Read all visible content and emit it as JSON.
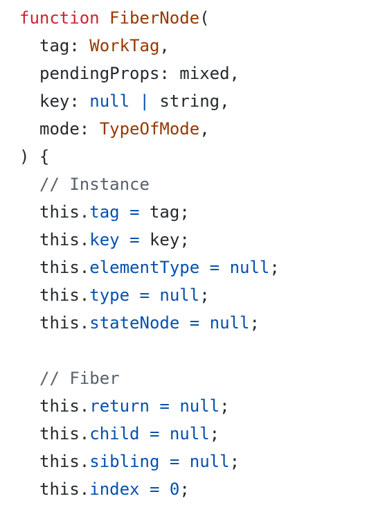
{
  "code": {
    "language": "javascript",
    "lines": [
      {
        "indent": 0,
        "tokens": [
          {
            "t": "function",
            "k": "keyword"
          },
          {
            "t": " ",
            "k": "plain"
          },
          {
            "t": "FiberNode",
            "k": "func"
          },
          {
            "t": "(",
            "k": "plain"
          }
        ]
      },
      {
        "indent": 1,
        "tokens": [
          {
            "t": "tag",
            "k": "param"
          },
          {
            "t": ": ",
            "k": "plain"
          },
          {
            "t": "WorkTag",
            "k": "type"
          },
          {
            "t": ",",
            "k": "plain"
          }
        ]
      },
      {
        "indent": 1,
        "tokens": [
          {
            "t": "pendingProps",
            "k": "param"
          },
          {
            "t": ": ",
            "k": "plain"
          },
          {
            "t": "mixed",
            "k": "plain"
          },
          {
            "t": ",",
            "k": "plain"
          }
        ]
      },
      {
        "indent": 1,
        "tokens": [
          {
            "t": "key",
            "k": "param"
          },
          {
            "t": ": ",
            "k": "plain"
          },
          {
            "t": "null",
            "k": "builtin"
          },
          {
            "t": " ",
            "k": "plain"
          },
          {
            "t": "|",
            "k": "op"
          },
          {
            "t": " string,",
            "k": "plain"
          }
        ]
      },
      {
        "indent": 1,
        "tokens": [
          {
            "t": "mode",
            "k": "param"
          },
          {
            "t": ": ",
            "k": "plain"
          },
          {
            "t": "TypeOfMode",
            "k": "type"
          },
          {
            "t": ",",
            "k": "plain"
          }
        ]
      },
      {
        "indent": 0,
        "tokens": [
          {
            "t": ") {",
            "k": "plain"
          }
        ]
      },
      {
        "indent": 1,
        "tokens": [
          {
            "t": "// Instance",
            "k": "comment"
          }
        ]
      },
      {
        "indent": 1,
        "tokens": [
          {
            "t": "this",
            "k": "plain"
          },
          {
            "t": ".",
            "k": "plain"
          },
          {
            "t": "tag",
            "k": "prop"
          },
          {
            "t": " ",
            "k": "plain"
          },
          {
            "t": "=",
            "k": "op"
          },
          {
            "t": " tag;",
            "k": "plain"
          }
        ]
      },
      {
        "indent": 1,
        "tokens": [
          {
            "t": "this",
            "k": "plain"
          },
          {
            "t": ".",
            "k": "plain"
          },
          {
            "t": "key",
            "k": "prop"
          },
          {
            "t": " ",
            "k": "plain"
          },
          {
            "t": "=",
            "k": "op"
          },
          {
            "t": " key;",
            "k": "plain"
          }
        ]
      },
      {
        "indent": 1,
        "tokens": [
          {
            "t": "this",
            "k": "plain"
          },
          {
            "t": ".",
            "k": "plain"
          },
          {
            "t": "elementType",
            "k": "prop"
          },
          {
            "t": " ",
            "k": "plain"
          },
          {
            "t": "=",
            "k": "op"
          },
          {
            "t": " ",
            "k": "plain"
          },
          {
            "t": "null",
            "k": "builtin"
          },
          {
            "t": ";",
            "k": "plain"
          }
        ]
      },
      {
        "indent": 1,
        "tokens": [
          {
            "t": "this",
            "k": "plain"
          },
          {
            "t": ".",
            "k": "plain"
          },
          {
            "t": "type",
            "k": "prop"
          },
          {
            "t": " ",
            "k": "plain"
          },
          {
            "t": "=",
            "k": "op"
          },
          {
            "t": " ",
            "k": "plain"
          },
          {
            "t": "null",
            "k": "builtin"
          },
          {
            "t": ";",
            "k": "plain"
          }
        ]
      },
      {
        "indent": 1,
        "tokens": [
          {
            "t": "this",
            "k": "plain"
          },
          {
            "t": ".",
            "k": "plain"
          },
          {
            "t": "stateNode",
            "k": "prop"
          },
          {
            "t": " ",
            "k": "plain"
          },
          {
            "t": "=",
            "k": "op"
          },
          {
            "t": " ",
            "k": "plain"
          },
          {
            "t": "null",
            "k": "builtin"
          },
          {
            "t": ";",
            "k": "plain"
          }
        ]
      },
      {
        "indent": 0,
        "tokens": []
      },
      {
        "indent": 1,
        "tokens": [
          {
            "t": "// Fiber",
            "k": "comment"
          }
        ]
      },
      {
        "indent": 1,
        "tokens": [
          {
            "t": "this",
            "k": "plain"
          },
          {
            "t": ".",
            "k": "plain"
          },
          {
            "t": "return",
            "k": "prop"
          },
          {
            "t": " ",
            "k": "plain"
          },
          {
            "t": "=",
            "k": "op"
          },
          {
            "t": " ",
            "k": "plain"
          },
          {
            "t": "null",
            "k": "builtin"
          },
          {
            "t": ";",
            "k": "plain"
          }
        ]
      },
      {
        "indent": 1,
        "tokens": [
          {
            "t": "this",
            "k": "plain"
          },
          {
            "t": ".",
            "k": "plain"
          },
          {
            "t": "child",
            "k": "prop"
          },
          {
            "t": " ",
            "k": "plain"
          },
          {
            "t": "=",
            "k": "op"
          },
          {
            "t": " ",
            "k": "plain"
          },
          {
            "t": "null",
            "k": "builtin"
          },
          {
            "t": ";",
            "k": "plain"
          }
        ]
      },
      {
        "indent": 1,
        "tokens": [
          {
            "t": "this",
            "k": "plain"
          },
          {
            "t": ".",
            "k": "plain"
          },
          {
            "t": "sibling",
            "k": "prop"
          },
          {
            "t": " ",
            "k": "plain"
          },
          {
            "t": "=",
            "k": "op"
          },
          {
            "t": " ",
            "k": "plain"
          },
          {
            "t": "null",
            "k": "builtin"
          },
          {
            "t": ";",
            "k": "plain"
          }
        ]
      },
      {
        "indent": 1,
        "tokens": [
          {
            "t": "this",
            "k": "plain"
          },
          {
            "t": ".",
            "k": "plain"
          },
          {
            "t": "index",
            "k": "prop"
          },
          {
            "t": " ",
            "k": "plain"
          },
          {
            "t": "=",
            "k": "op"
          },
          {
            "t": " ",
            "k": "plain"
          },
          {
            "t": "0",
            "k": "number"
          },
          {
            "t": ";",
            "k": "plain"
          }
        ]
      }
    ]
  },
  "colors": {
    "background": "#ffffff",
    "keyword": "#cf222e",
    "function_name": "#953800",
    "type_name": "#953800",
    "property": "#0550ae",
    "builtin": "#0550ae",
    "operator": "#0550ae",
    "number": "#0550ae",
    "comment": "#57606a",
    "plain": "#24292e"
  }
}
